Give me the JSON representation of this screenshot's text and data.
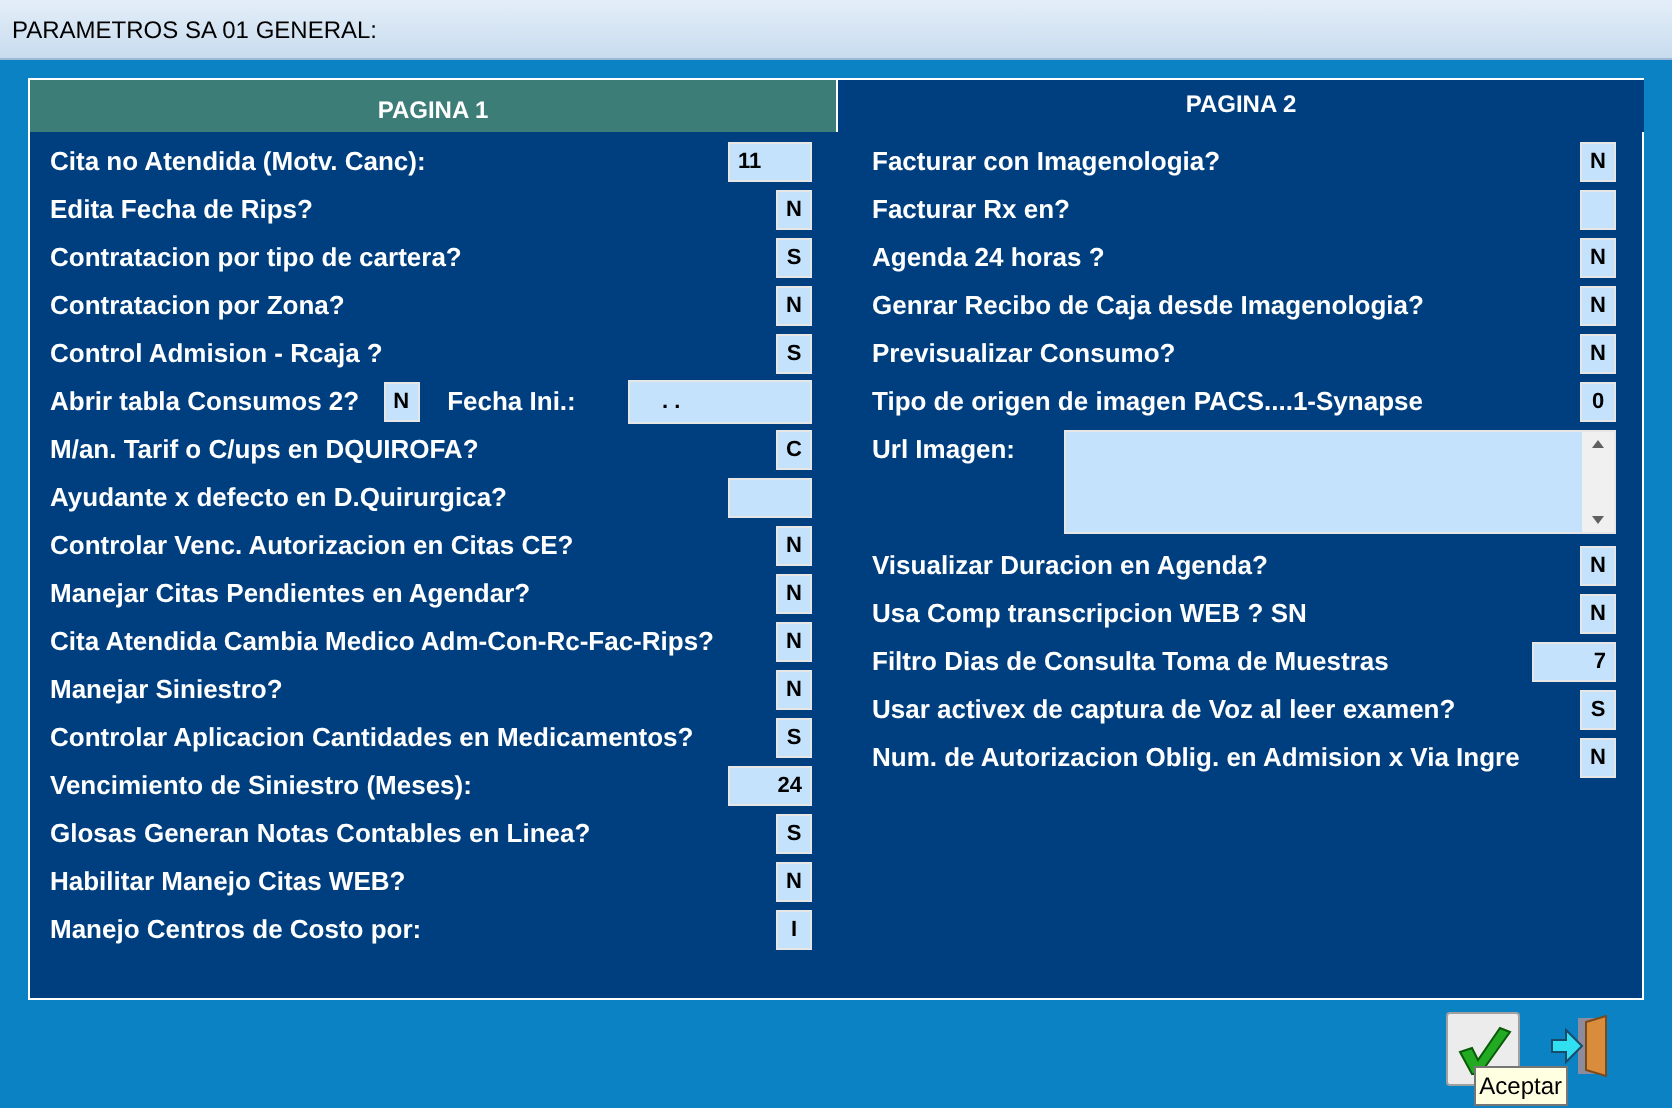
{
  "window": {
    "title": "PARAMETROS SA 01 GENERAL:"
  },
  "tabs": [
    {
      "label": "PAGINA 1",
      "selected": false
    },
    {
      "label": "PAGINA 2",
      "selected": true
    }
  ],
  "left_rows": [
    {
      "kind": "code",
      "label": "Cita no Atendida (Motv. Canc):",
      "value": "11"
    },
    {
      "kind": "flag",
      "label": "Edita Fecha de Rips?",
      "value": "N"
    },
    {
      "kind": "flag",
      "label": "Contratacion por tipo de cartera?",
      "value": "S"
    },
    {
      "kind": "flag",
      "label": "Contratacion por Zona?",
      "value": "N"
    },
    {
      "kind": "flag",
      "label": "Control Admision - Rcaja ?",
      "value": "S"
    },
    {
      "kind": "double",
      "label": "Abrir tabla Consumos 2?",
      "value": "N",
      "label_2": "Fecha Ini.:",
      "value_2": ". ."
    },
    {
      "kind": "flag",
      "label": "M/an. Tarif o C/ups en DQUIROFA?",
      "value": "C"
    },
    {
      "kind": "number",
      "label": "Ayudante x defecto en D.Quirurgica?"
    },
    {
      "kind": "flag",
      "label": "Controlar Venc. Autorizacion en Citas CE?",
      "value": "N"
    },
    {
      "kind": "flag",
      "label": "Manejar Citas Pendientes en Agendar?",
      "value": "N"
    },
    {
      "kind": "flag",
      "label": "Cita Atendida Cambia Medico Adm-Con-Rc-Fac-Rips?",
      "value": "N"
    },
    {
      "kind": "flag",
      "label": "Manejar Siniestro?",
      "value": "N"
    },
    {
      "kind": "flag",
      "label": "Controlar Aplicacion Cantidades en Medicamentos?",
      "value": "S"
    },
    {
      "kind": "number",
      "label": "Vencimiento de Siniestro (Meses):",
      "value": "24"
    },
    {
      "kind": "flag",
      "label": "Glosas Generan Notas Contables en Linea?",
      "value": "S"
    },
    {
      "kind": "flag",
      "label": "Habilitar Manejo Citas WEB?",
      "value": "N"
    },
    {
      "kind": "flag",
      "label": "Manejo Centros de Costo por:",
      "value": "I"
    }
  ],
  "right_rows": [
    {
      "kind": "flag",
      "label": "Facturar con Imagenologia?",
      "value": "N"
    },
    {
      "kind": "flag",
      "label": "Facturar Rx en?"
    },
    {
      "kind": "flag",
      "label": "Agenda 24 horas ?",
      "value": "N"
    },
    {
      "kind": "flag",
      "label": "Genrar Recibo de Caja desde Imagenologia?",
      "value": "N"
    },
    {
      "kind": "flag",
      "label": "Previsualizar Consumo?",
      "value": "N"
    },
    {
      "kind": "flag",
      "label": "Tipo de origen de imagen  PACS....1-Synapse",
      "value": "0"
    },
    {
      "kind": "textarea",
      "label": "Url Imagen:"
    },
    {
      "kind": "flag",
      "label": "Visualizar Duracion en Agenda?",
      "value": "N"
    },
    {
      "kind": "flag",
      "label": "Usa Comp transcripcion WEB ? SN",
      "value": "N"
    },
    {
      "kind": "number",
      "label": "Filtro Dias de Consulta Toma de Muestras",
      "value": "7"
    },
    {
      "kind": "flag",
      "label": "Usar activex de captura de Voz al leer examen?",
      "value": "S"
    },
    {
      "kind": "flag",
      "label": "Num. de Autorizacion Oblig. en Admision x Via Ingre",
      "value": "N"
    }
  ],
  "tooltip": "Aceptar"
}
